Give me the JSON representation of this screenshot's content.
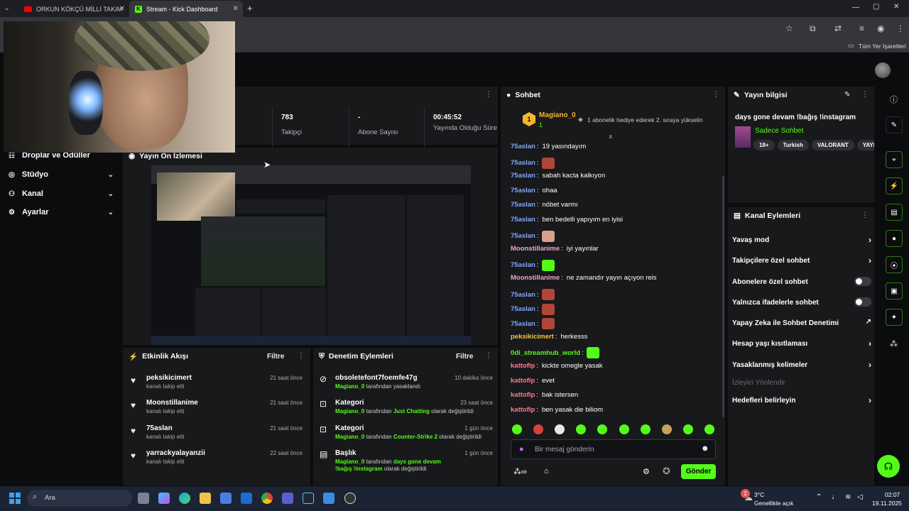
{
  "browser": {
    "tabs": [
      {
        "title": "ORKUN KÖKÇÜ MİLLİ TAKIMDA",
        "active": false
      },
      {
        "title": "Stream - Kick Dashboard",
        "active": true
      }
    ],
    "new_tab": "+",
    "bookmarks_label": "Tüm Yer İşaretleri"
  },
  "sidebar": {
    "items": [
      {
        "label": "Droplar ve Ödüller"
      },
      {
        "label": "Stüdyo"
      },
      {
        "label": "Kanal"
      },
      {
        "label": "Ayarlar"
      }
    ]
  },
  "stats": [
    {
      "value": "783",
      "label": "Takipçi"
    },
    {
      "value": "-",
      "label": "Abone Sayısı"
    },
    {
      "value": "00:45:52",
      "label": "Yayında Olduğu Süre"
    }
  ],
  "preview": {
    "title": "Yayın Ön İzlemesi"
  },
  "activity": {
    "title": "Etkinlik Akışı",
    "filter": "Filtre",
    "items": [
      {
        "name": "peksikicimert",
        "sub": "kanalı takip etti",
        "time": "21 saat önce"
      },
      {
        "name": "Moonstillanime",
        "sub": "kanalı takip etti",
        "time": "21 saat önce"
      },
      {
        "name": "75aslan",
        "sub": "kanalı takip etti",
        "time": "21 saat önce"
      },
      {
        "name": "yarrackyalayanzii",
        "sub": "kanalı takip etti",
        "time": "22 saat önce"
      }
    ]
  },
  "moderation": {
    "title": "Denetim Eylemleri",
    "filter": "Filtre",
    "items": [
      {
        "name": "obsoletefont7foemfe47g",
        "time": "10 dakika önce",
        "actor": "Magiano_0",
        "mid": " tarafından yasaklandı",
        "value": "",
        "tail": ""
      },
      {
        "name": "Kategori",
        "time": "23 saat önce",
        "actor": "Magiano_0",
        "mid": " tarafından ",
        "value": "Just Chatting",
        "tail": " olarak değiştirildi"
      },
      {
        "name": "Kategori",
        "time": "1 gün önce",
        "actor": "Magiano_0",
        "mid": " tarafından ",
        "value": "Counter-Strike 2",
        "tail": " olarak değiştirildi"
      },
      {
        "name": "Başlık",
        "time": "1 gün önce",
        "actor": "Magiano_0",
        "mid": " tarafından ",
        "value": "days gone devam !bağış !instagram",
        "tail": " olarak değiştirildi"
      }
    ]
  },
  "chat": {
    "title": "Sohbet",
    "pinned_user": "Magiano_0",
    "pinned_count": "1",
    "pinned_text": "1 abonelik hediye ederek 2. sıraya yükselin",
    "messages": [
      {
        "user": "75aslan",
        "text": "19 yasındayım",
        "color": "#7fa8ff",
        "emote": ""
      },
      {
        "user": "75aslan",
        "text": "",
        "color": "#7fa8ff",
        "emote": "#b0463a"
      },
      {
        "user": "75aslan",
        "text": "sabah kacta kalkıyon",
        "color": "#7fa8ff",
        "emote": ""
      },
      {
        "user": "75aslan",
        "text": "ohaa",
        "color": "#7fa8ff",
        "emote": ""
      },
      {
        "user": "75aslan",
        "text": "nöbet varmı",
        "color": "#7fa8ff",
        "emote": ""
      },
      {
        "user": "75aslan",
        "text": "ben bedelli yapıyım en iyisi",
        "color": "#7fa8ff",
        "emote": ""
      },
      {
        "user": "75aslan",
        "text": "",
        "color": "#7fa8ff",
        "emote": "#d4a08a"
      },
      {
        "user": "Moonstillanime",
        "text": "iyi yayınlar",
        "color": "#f0a6c8",
        "emote": ""
      },
      {
        "user": "75aslan",
        "text": "",
        "color": "#7fa8ff",
        "emote": "#53fc18"
      },
      {
        "user": "Moonstillanime",
        "text": "ne zamandır yayın açıyon reis",
        "color": "#f0a6c8",
        "emote": ""
      },
      {
        "user": "75aslan",
        "text": "",
        "color": "#7fa8ff",
        "emote": "#b0463a"
      },
      {
        "user": "75aslan",
        "text": "",
        "color": "#7fa8ff",
        "emote": "#b0463a"
      },
      {
        "user": "75aslan",
        "text": "",
        "color": "#7fa8ff",
        "emote": "#b0463a"
      },
      {
        "user": "peksikicimert",
        "text": "herkesss",
        "color": "#f5c542",
        "emote": ""
      },
      {
        "user": "0di_streamhub_world",
        "text": "",
        "color": "#53fc18",
        "emote": "#53fc18"
      },
      {
        "user": "kattoflp",
        "text": "kickte omegle yasak",
        "color": "#ff7a8a",
        "emote": ""
      },
      {
        "user": "kattoflp",
        "text": "evet",
        "color": "#ff7a8a",
        "emote": ""
      },
      {
        "user": "kattoflp",
        "text": "bak istersen",
        "color": "#ff7a8a",
        "emote": ""
      },
      {
        "user": "kattoflp",
        "text": "ben yasak die biliom",
        "color": "#ff7a8a",
        "emote": ""
      }
    ],
    "input_placeholder": "Bir mesaj gönderin",
    "send": "Gönder"
  },
  "stream_info": {
    "title": "Yayın bilgisi",
    "stream_title": "days gone devam !bağış !instagram",
    "category": "Sadece Sohbet",
    "chips": [
      "18+",
      "Turkish",
      "VALORANT",
      "YAYIN"
    ]
  },
  "channel_actions": {
    "title": "Kanal Eylemleri",
    "rows": [
      {
        "label": "Yavaş mod",
        "kind": "arrow",
        "disabled": false
      },
      {
        "label": "Takipçilere özel sohbet",
        "kind": "arrow",
        "disabled": false
      },
      {
        "label": "Abonelere özel sohbet",
        "kind": "toggle",
        "disabled": false
      },
      {
        "label": "Yalnızca ifadelerle sohbet",
        "kind": "toggle",
        "disabled": false
      },
      {
        "label": "Yapay Zeka ile Sohbet Denetimi",
        "kind": "external",
        "disabled": false
      },
      {
        "label": "Hesap yaşı kısıtlaması",
        "kind": "arrow",
        "disabled": false
      },
      {
        "label": "Yasaklanmış kelimeler",
        "kind": "arrow",
        "disabled": false
      },
      {
        "label": "İzleyici Yönlendir",
        "kind": "none",
        "disabled": true
      },
      {
        "label": "Hedefleri belirleyin",
        "kind": "arrow",
        "disabled": false
      }
    ]
  },
  "taskbar": {
    "search": "Ara",
    "weather_temp": "3°C",
    "weather_desc": "Genellikle açık",
    "time": "02:07",
    "date": "19.11.2025",
    "weather_badge": "2"
  },
  "colors": {
    "accent": "#53fc18",
    "panel": "#18191b",
    "bg": "#0b0c0e"
  }
}
